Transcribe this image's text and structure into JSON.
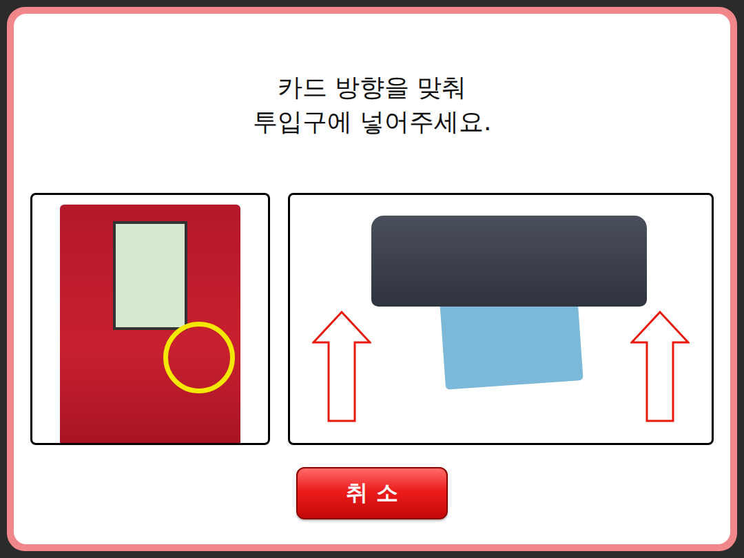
{
  "prompt": {
    "lines": [
      "카드 방향을 맞춰",
      "투입구에 넣어주세요."
    ]
  },
  "buttons": [
    {
      "label": "취 소"
    }
  ]
}
